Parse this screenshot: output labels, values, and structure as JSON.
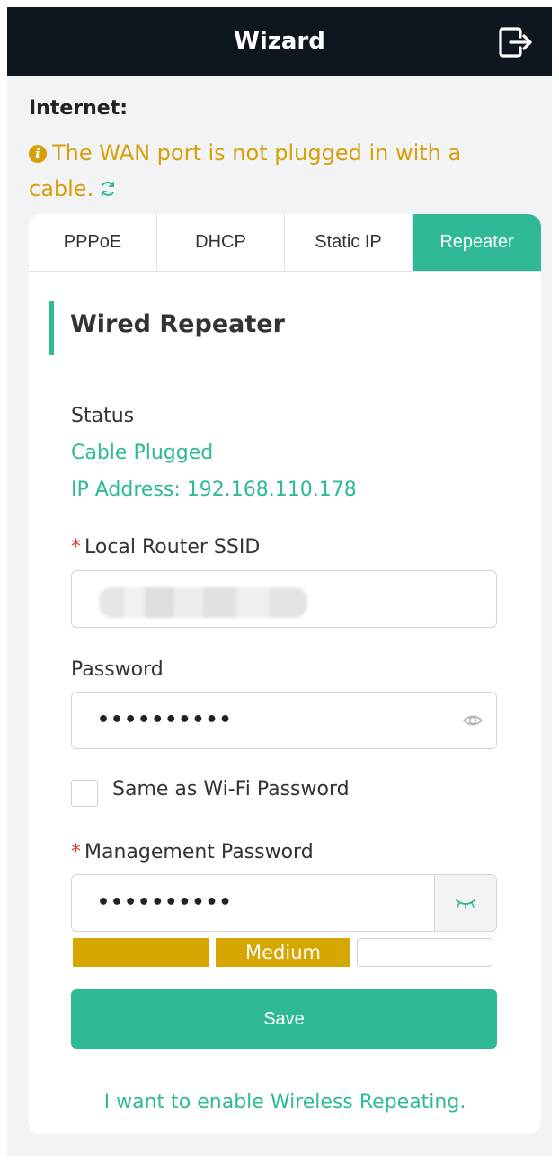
{
  "header": {
    "title": "Wizard",
    "exit_icon": "logout-icon"
  },
  "internet": {
    "label": "Internet:",
    "warning": "The WAN port is not plugged in with a cable.",
    "warning_color": "#d7a008"
  },
  "tabs": [
    {
      "label": "PPPoE",
      "active": false
    },
    {
      "label": "DHCP",
      "active": false
    },
    {
      "label": "Static IP",
      "active": false
    },
    {
      "label": "Repeater",
      "active": true
    }
  ],
  "accent_color": "#2fb996",
  "section": {
    "title": "Wired Repeater"
  },
  "status": {
    "label": "Status",
    "state": "Cable Plugged",
    "ip": "IP Address: 192.168.110.178"
  },
  "fields": {
    "ssid": {
      "label": "Local Router SSID",
      "required": "*"
    },
    "password": {
      "label": "Password",
      "value": "••••••••••"
    },
    "same_as_wifi": {
      "label": "Same as Wi-Fi Password",
      "checked": false
    },
    "mgmt_password": {
      "label": "Management Password",
      "required": "*",
      "value": "••••••••••"
    }
  },
  "strength": {
    "label": "Medium",
    "level": 2,
    "max": 3
  },
  "actions": {
    "save": "Save",
    "wireless_link": "I want to enable Wireless Repeating."
  }
}
